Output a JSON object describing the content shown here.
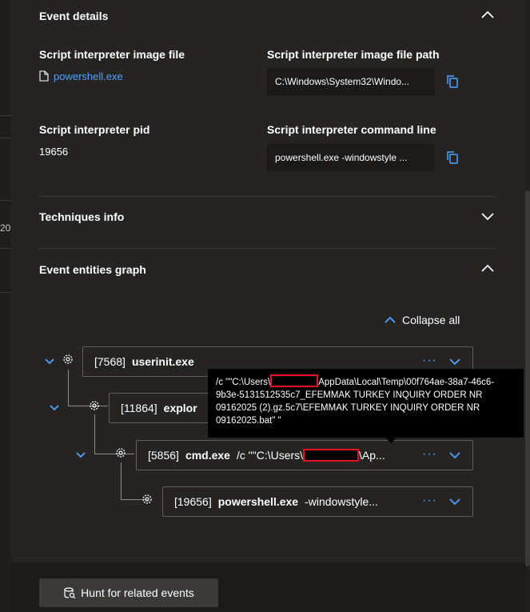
{
  "event_details": {
    "heading": "Event details",
    "image_file_label": "Script interpreter image file",
    "image_file_value": "powershell.exe",
    "image_path_label": "Script interpreter image file path",
    "image_path_value": "C:\\Windows\\System32\\Windo...",
    "pid_label": "Script interpreter pid",
    "pid_value": "19656",
    "cmdline_label": "Script interpreter command line",
    "cmdline_value": "powershell.exe  -windowstyle ..."
  },
  "techniques": {
    "heading": "Techniques info"
  },
  "graph": {
    "heading": "Event entities graph",
    "collapse_all": "Collapse all",
    "nodes": [
      {
        "pid": "[7568]",
        "name": "userinit.exe",
        "args": ""
      },
      {
        "pid": "[11864]",
        "name": "explor",
        "args": ""
      },
      {
        "pid": "[5856]",
        "name": "cmd.exe",
        "args_pre": "/c \"\"C:\\Users\\",
        "args_post": "\\Ap..."
      },
      {
        "pid": "[19656]",
        "name": "powershell.exe",
        "args": "-windowstyle..."
      }
    ],
    "more_label": "···",
    "tooltip": {
      "pre": "/c \"\"C:\\Users\\",
      "post": "AppData\\Local\\Temp\\00f764ae-38a7-46c6-9b3e-5131512535c7_EFEMMAK TURKEY INQUIRY ORDER NR 09162025 (2).gz.5c7\\EFEMMAK TURKEY INQUIRY ORDER NR 09162025.bat\" \""
    }
  },
  "footer": {
    "hunt_label": "Hunt for related events"
  },
  "background": {
    "cut_text": "20"
  },
  "colors": {
    "accent": "#4da3ff",
    "panel": "#252423",
    "redact_border": "#e81123"
  }
}
